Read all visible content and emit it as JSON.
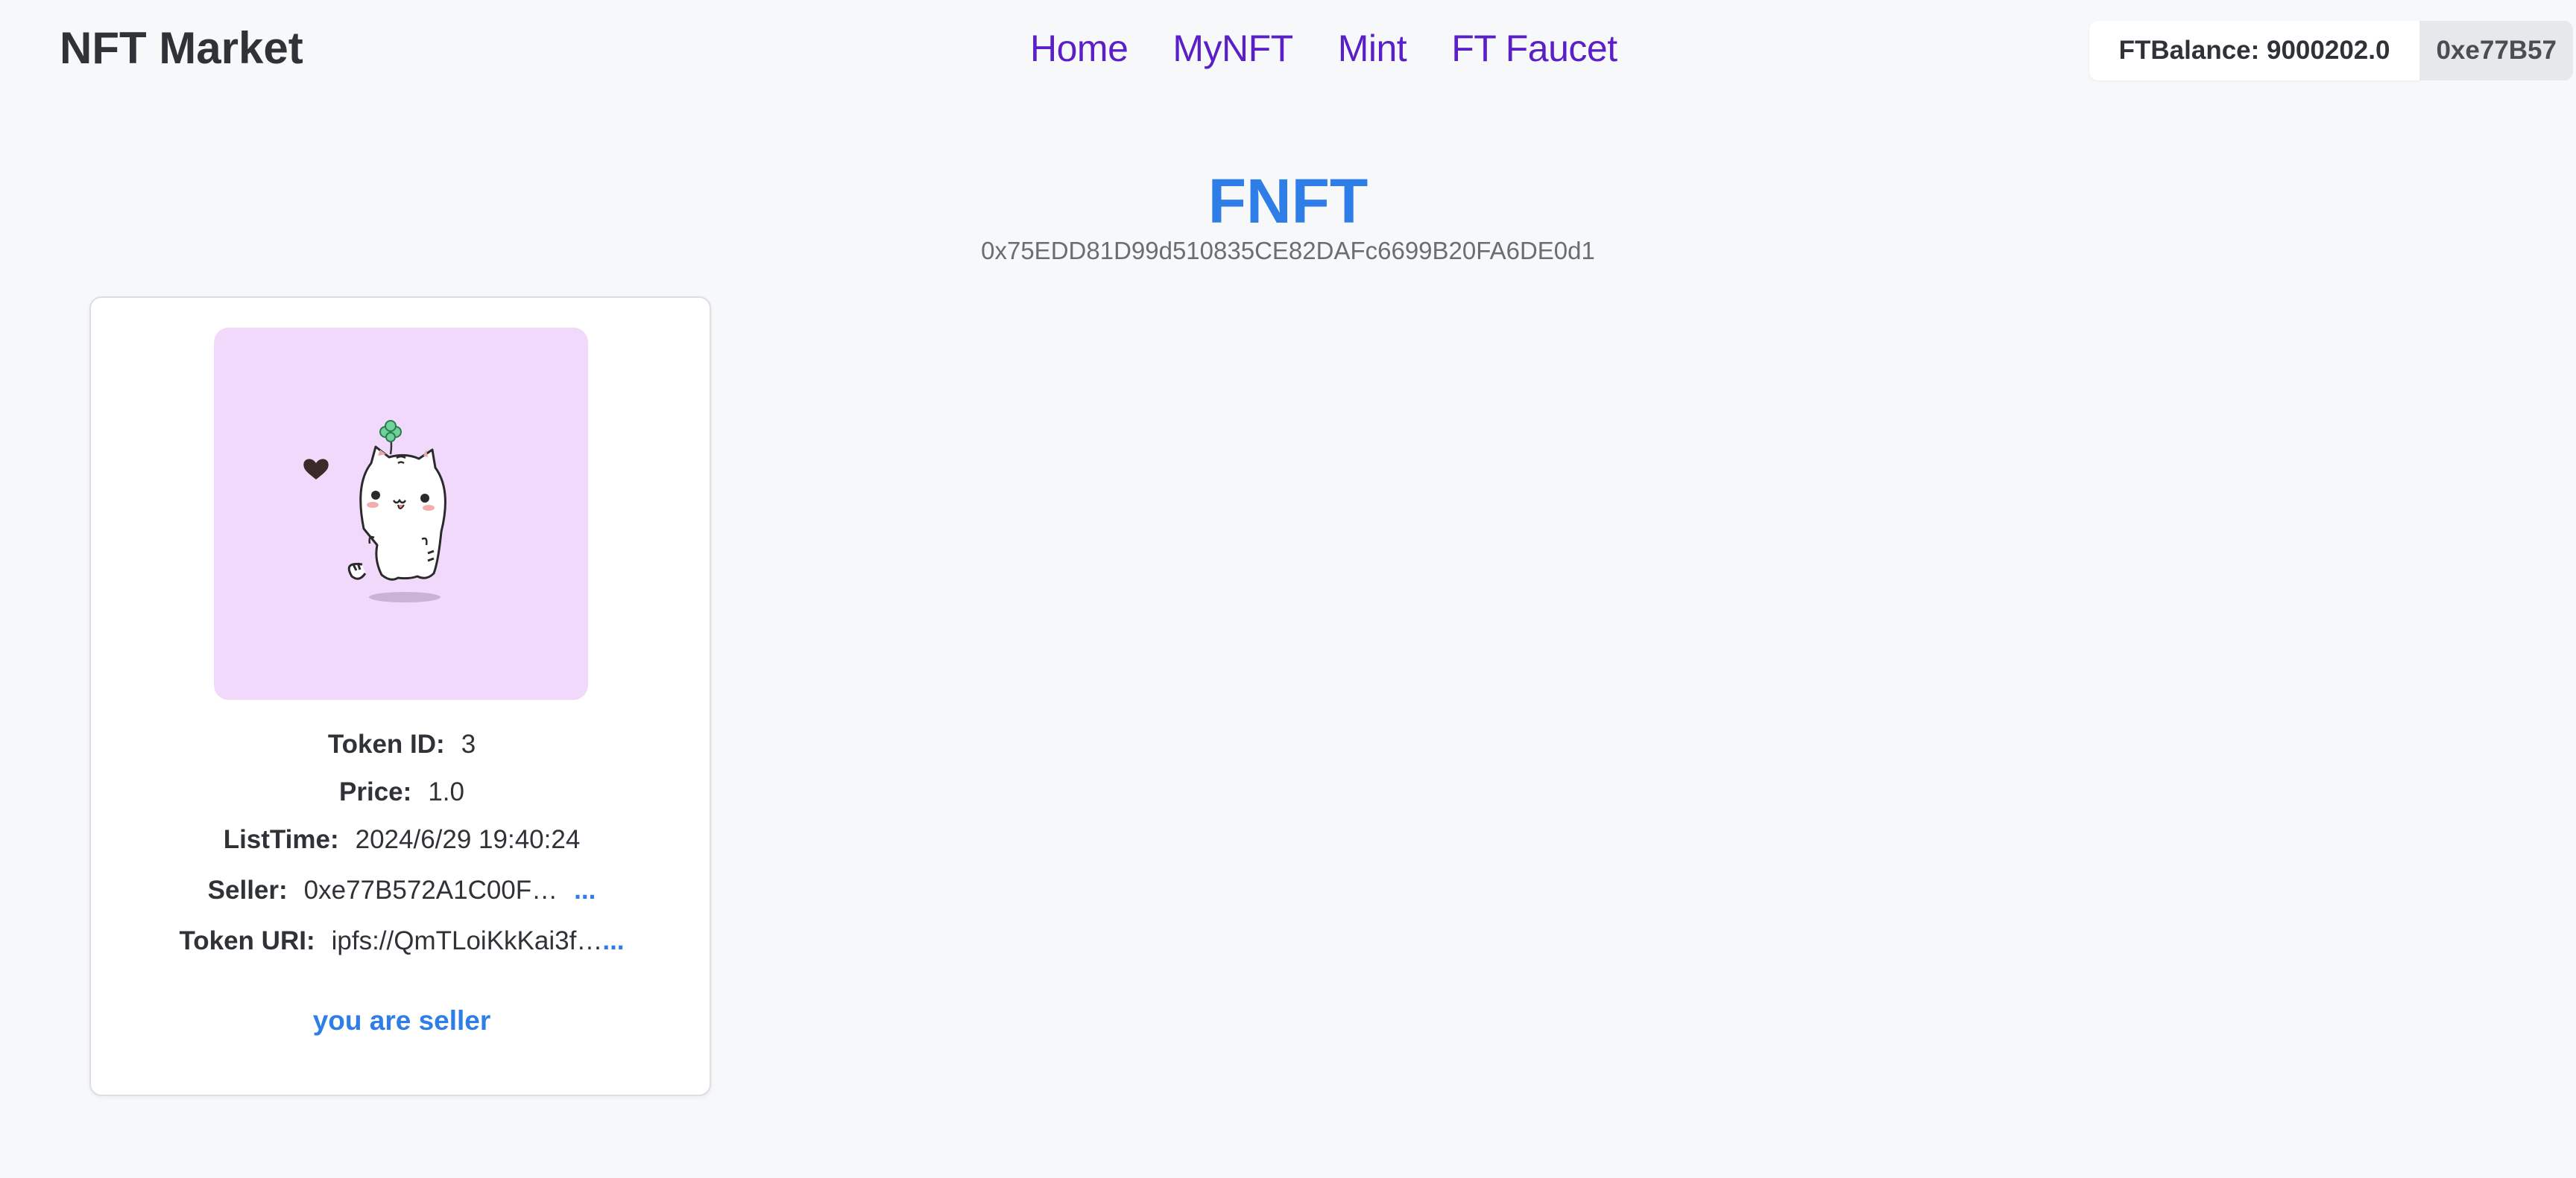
{
  "header": {
    "logo": "NFT Market",
    "nav": [
      "Home",
      "MyNFT",
      "Mint",
      "FT Faucet"
    ],
    "balance": "FTBalance: 9000202.0",
    "address": "0xe77B57"
  },
  "collection": {
    "title": "FNFT",
    "address": "0x75EDD81D99d510835CE82DAFc6699B20FA6DE0d1"
  },
  "card": {
    "token_id_label": "Token ID:",
    "token_id": "3",
    "price_label": "Price:",
    "price": "1.0",
    "list_time_label": "ListTime:",
    "list_time": "2024/6/29 19:40:24",
    "seller_label": "Seller:",
    "seller": "0xe77B572A1C00F…",
    "seller_more": "...",
    "token_uri_label": "Token URI:",
    "token_uri": "ipfs://QmTLoiKkKai3f…",
    "token_uri_more": "...",
    "status": "you are seller"
  },
  "colors": {
    "accent": "#2f7de6",
    "nav": "#5b1fc7",
    "image_bg": "#f1d9fb"
  }
}
